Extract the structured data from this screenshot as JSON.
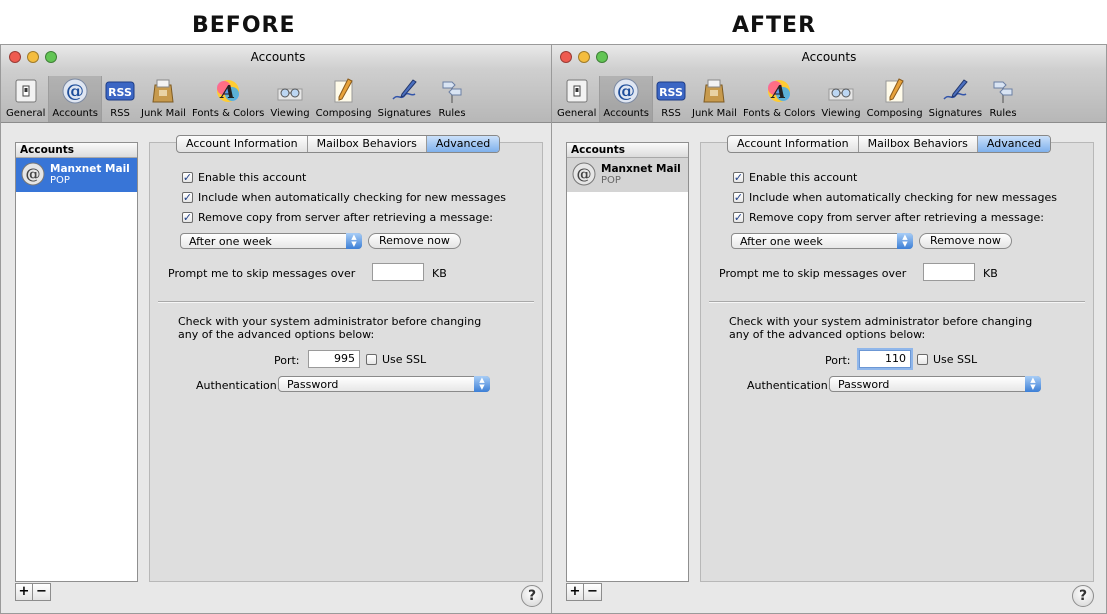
{
  "captions": {
    "before": "BEFORE",
    "after": "AFTER"
  },
  "colors": {
    "close": "#ee5b50",
    "minimize": "#f4bd3f",
    "zoom": "#62c554",
    "selection_active": "#3875d7",
    "selection_inactive": "#d4d4d4"
  },
  "toolbar": {
    "items": [
      {
        "label": "General",
        "icon": "general-switch-icon"
      },
      {
        "label": "Accounts",
        "icon": "at-sign-icon"
      },
      {
        "label": "RSS",
        "icon": "rss-icon"
      },
      {
        "label": "Junk Mail",
        "icon": "junk-mail-bag-icon"
      },
      {
        "label": "Fonts & Colors",
        "icon": "font-a-icon"
      },
      {
        "label": "Viewing",
        "icon": "glasses-icon"
      },
      {
        "label": "Composing",
        "icon": "pencil-paper-icon"
      },
      {
        "label": "Signatures",
        "icon": "pen-signature-icon"
      },
      {
        "label": "Rules",
        "icon": "rules-sign-icon"
      }
    ]
  },
  "before": {
    "title": "Accounts",
    "accounts_header": "Accounts",
    "account": {
      "name": "Manxnet Mail",
      "type": "POP"
    },
    "tabs": [
      "Account Information",
      "Mailbox Behaviors",
      "Advanced"
    ],
    "enable": "Enable this account",
    "include": "Include when automatically checking for new messages",
    "remove_copy": "Remove copy from server after retrieving a message:",
    "remove_when": "After one week",
    "remove_now": "Remove now",
    "prompt": "Prompt me to skip messages over",
    "prompt_value": "",
    "kb": "KB",
    "admin_note_1": "Check with your system administrator before changing",
    "admin_note_2": "any of the advanced options below:",
    "port_label": "Port:",
    "port_value": "995",
    "ssl": "Use SSL",
    "auth_label": "Authentication:",
    "auth_value": "Password",
    "add": "+",
    "remove": "−",
    "help": "?"
  },
  "after": {
    "title": "Accounts",
    "accounts_header": "Accounts",
    "account": {
      "name": "Manxnet Mail",
      "type": "POP"
    },
    "tabs": [
      "Account Information",
      "Mailbox Behaviors",
      "Advanced"
    ],
    "enable": "Enable this account",
    "include": "Include when automatically checking for new messages",
    "remove_copy": "Remove copy from server after retrieving a message:",
    "remove_when": "After one week",
    "remove_now": "Remove now",
    "prompt": "Prompt me to skip messages over",
    "prompt_value": "",
    "kb": "KB",
    "admin_note_1": "Check with your system administrator before changing",
    "admin_note_2": "any of the advanced options below:",
    "port_label": "Port:",
    "port_value": "110",
    "ssl": "Use SSL",
    "auth_label": "Authentication:",
    "auth_value": "Password",
    "add": "+",
    "remove": "−",
    "help": "?"
  }
}
